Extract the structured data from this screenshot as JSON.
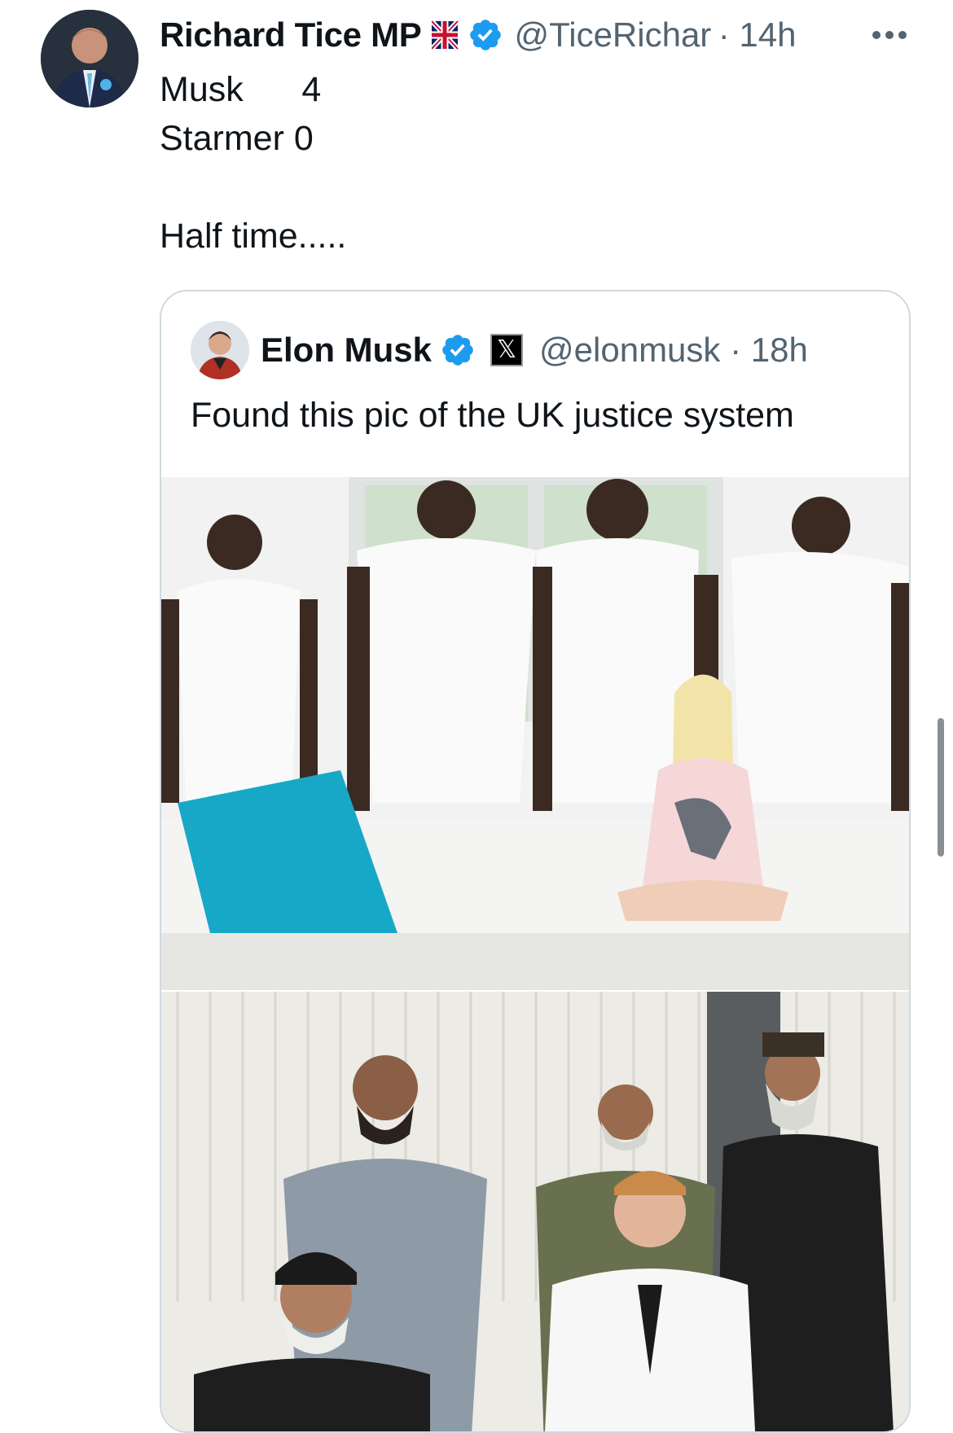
{
  "tweet": {
    "author_name": "Richard Tice MP",
    "handle_time": "@TiceRichar · 14h",
    "text": "Musk      4\nStarmer 0\n\nHalf time.....",
    "icons": [
      "flag-icon",
      "verified-icon",
      "more-icon"
    ]
  },
  "quoted_tweet": {
    "author_name": "Elon Musk",
    "handle_time": "@elonmusk · 18h",
    "text": "Found this pic of the UK justice system",
    "badge_glyph": "𝕏",
    "icons": [
      "verified-icon",
      "x-badge-icon"
    ]
  },
  "colors": {
    "verified_blue": "#1d9bf0",
    "secondary_text": "#536471",
    "border": "#cfd9de"
  }
}
